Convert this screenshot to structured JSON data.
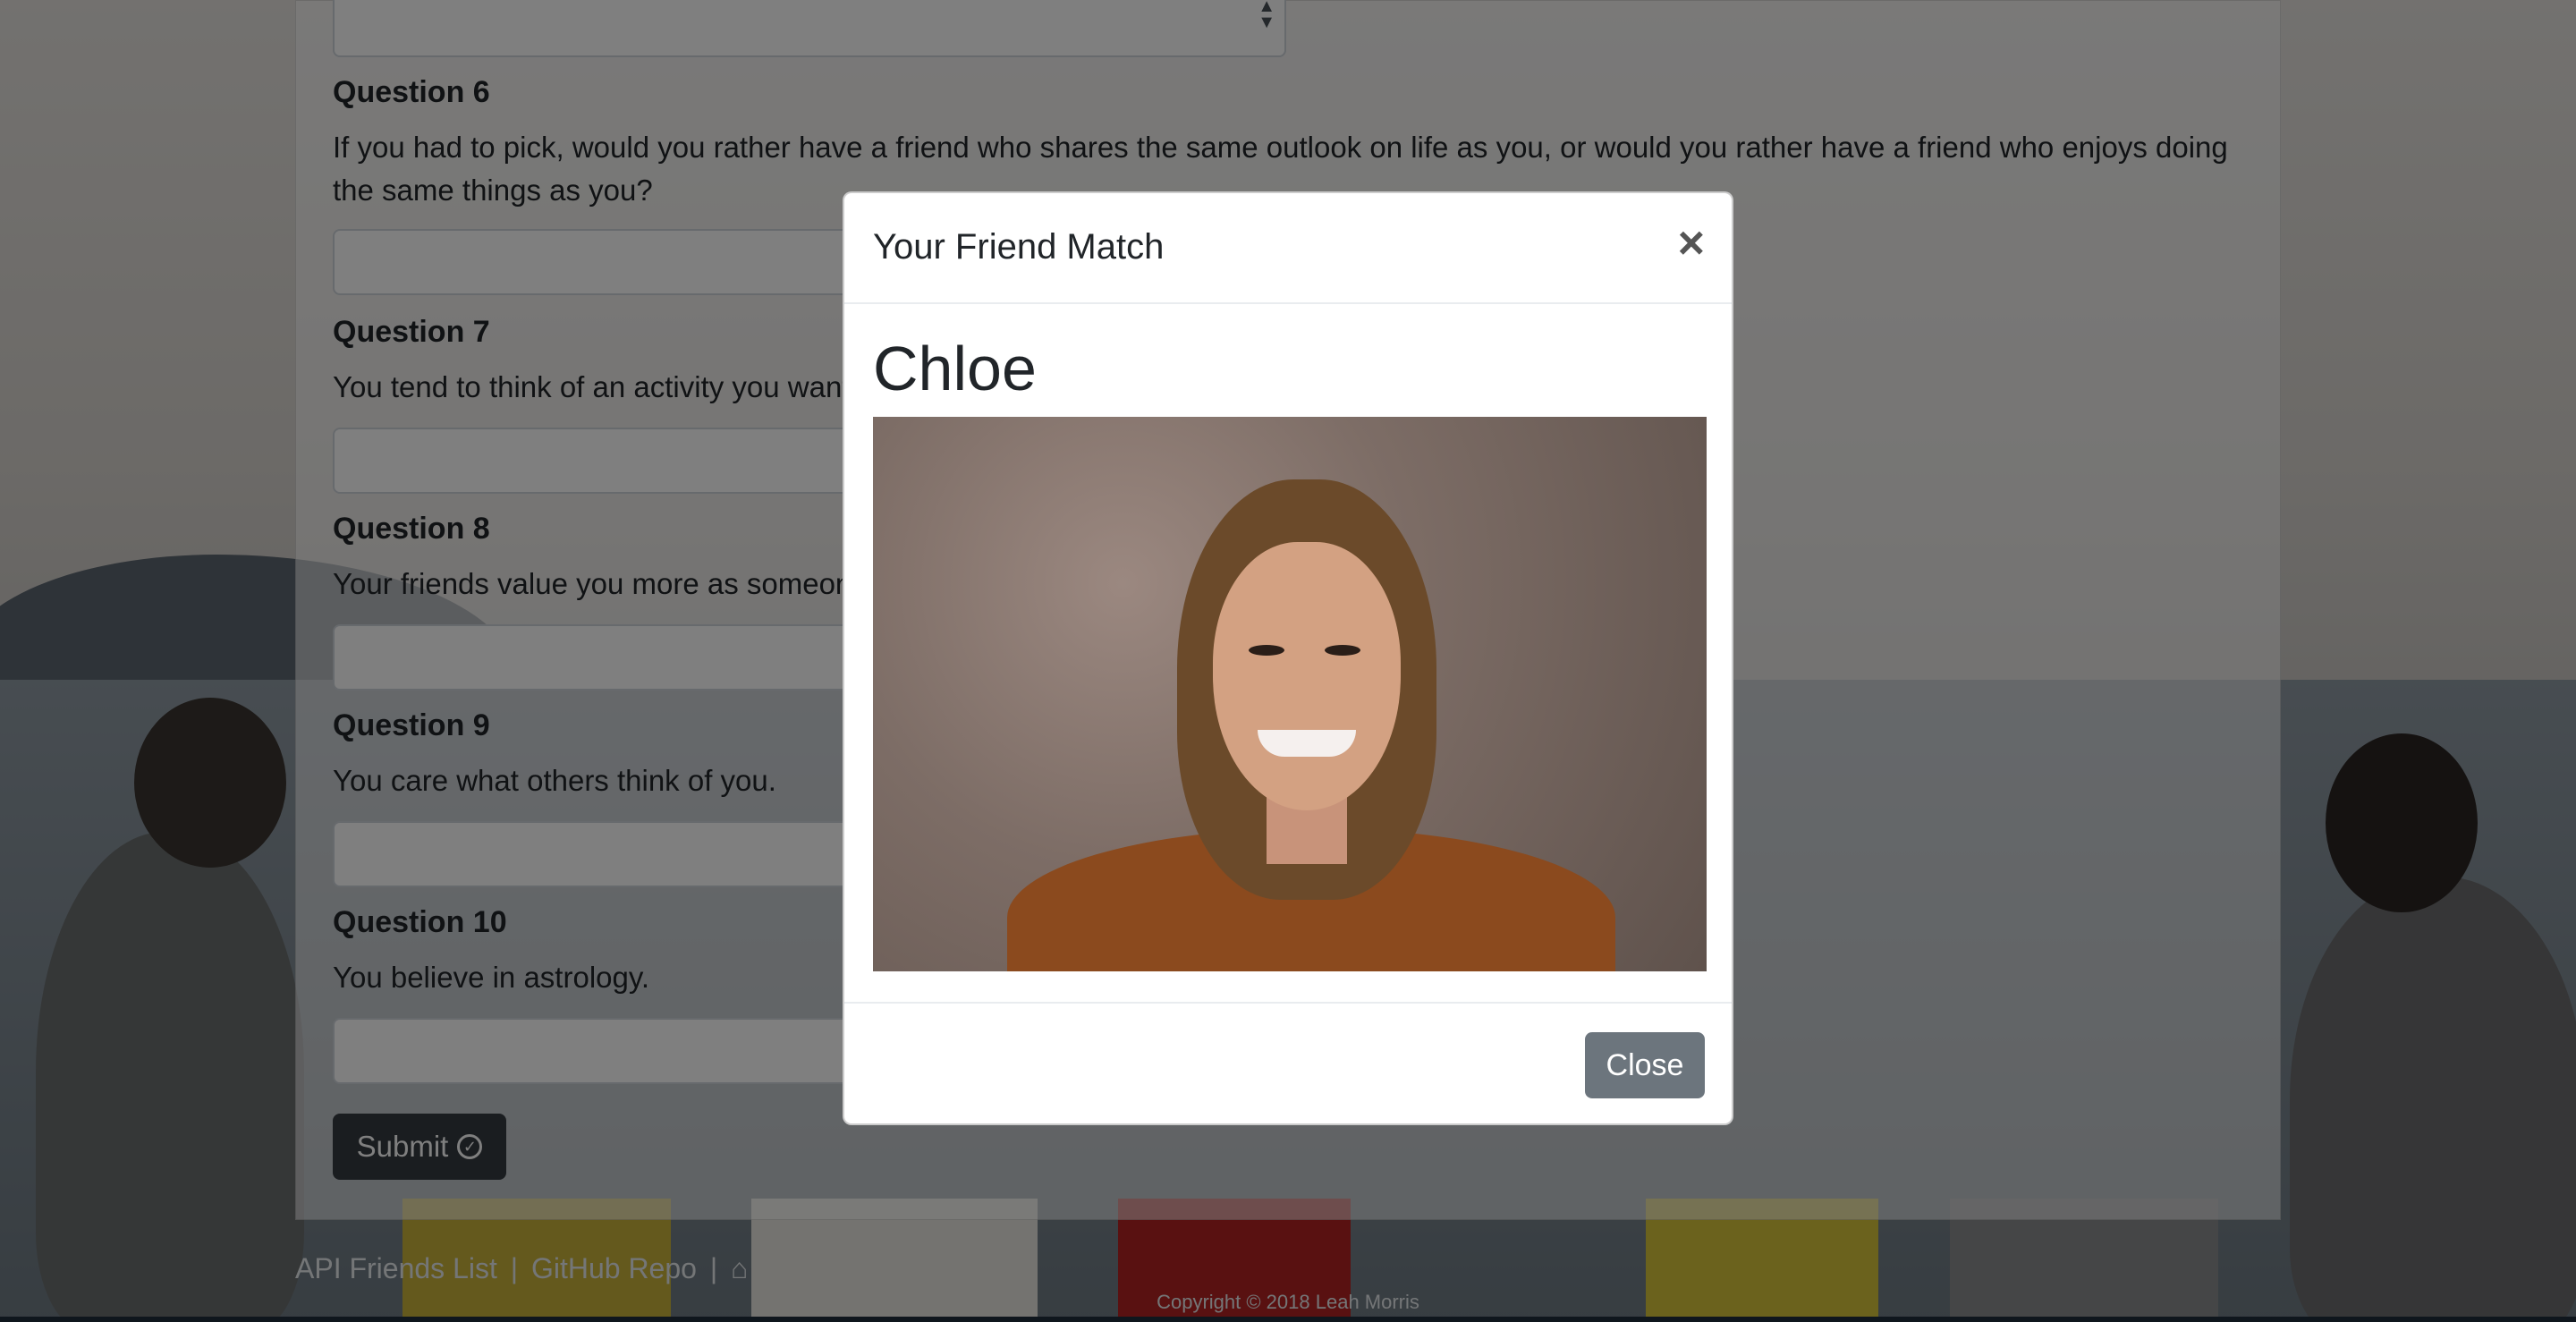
{
  "questions": [
    {
      "title": "Question 6",
      "text": "If you had to pick, would you rather have a friend who shares the same outlook on life as you, or would you rather have a friend who enjoys doing the same things as you?"
    },
    {
      "title": "Question 7",
      "text": "You tend to think of an activity you want"
    },
    {
      "title": "Question 8",
      "text": "Your friends value you more as someon"
    },
    {
      "title": "Question 9",
      "text": "You care what others think of you."
    },
    {
      "title": "Question 10",
      "text": "You believe in astrology."
    }
  ],
  "form": {
    "select_arrow_icon": "up-down-arrows-icon",
    "submit_label": "Submit",
    "submit_icon": "check-circle-icon"
  },
  "footer": {
    "link_api": "API Friends List",
    "separator": "|",
    "link_github": "GitHub Repo",
    "home_icon": "home-icon",
    "copyright": "Copyright © 2018 Leah Morris"
  },
  "modal": {
    "title": "Your Friend Match",
    "close_x": "×",
    "match_name": "Chloe",
    "photo_icon": "profile-photo",
    "close_label": "Close"
  },
  "colors": {
    "submit_bg": "#343a40",
    "close_btn_bg": "#6c757d",
    "backdrop": "rgba(0,0,0,0.5)"
  }
}
